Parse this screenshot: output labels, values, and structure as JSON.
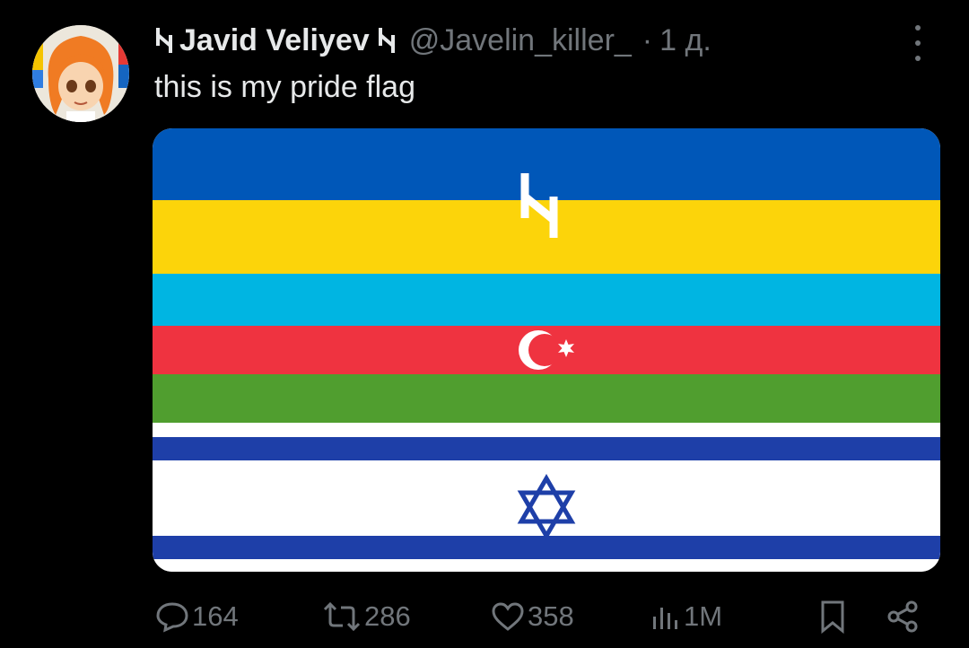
{
  "post": {
    "display_name": "Javid Veliyev",
    "handle": "@Javelin_killer_",
    "separator": "·",
    "time": "1 д.",
    "text": "this is my pride flag"
  },
  "media": {
    "stripe_colors": [
      "#0057b8",
      "#fcd40a",
      "#00b5e2",
      "#ef3340",
      "#509e2f",
      "#ffffff",
      "#1e3fa8"
    ],
    "icons": [
      "wolfsangel-icon",
      "crescent-star-icon",
      "star-of-david-icon"
    ]
  },
  "actions": {
    "replies": "164",
    "reposts": "286",
    "likes": "358",
    "views": "1M"
  },
  "colors": {
    "background": "#000000",
    "text": "#e7e9ea",
    "muted": "#71767b"
  }
}
